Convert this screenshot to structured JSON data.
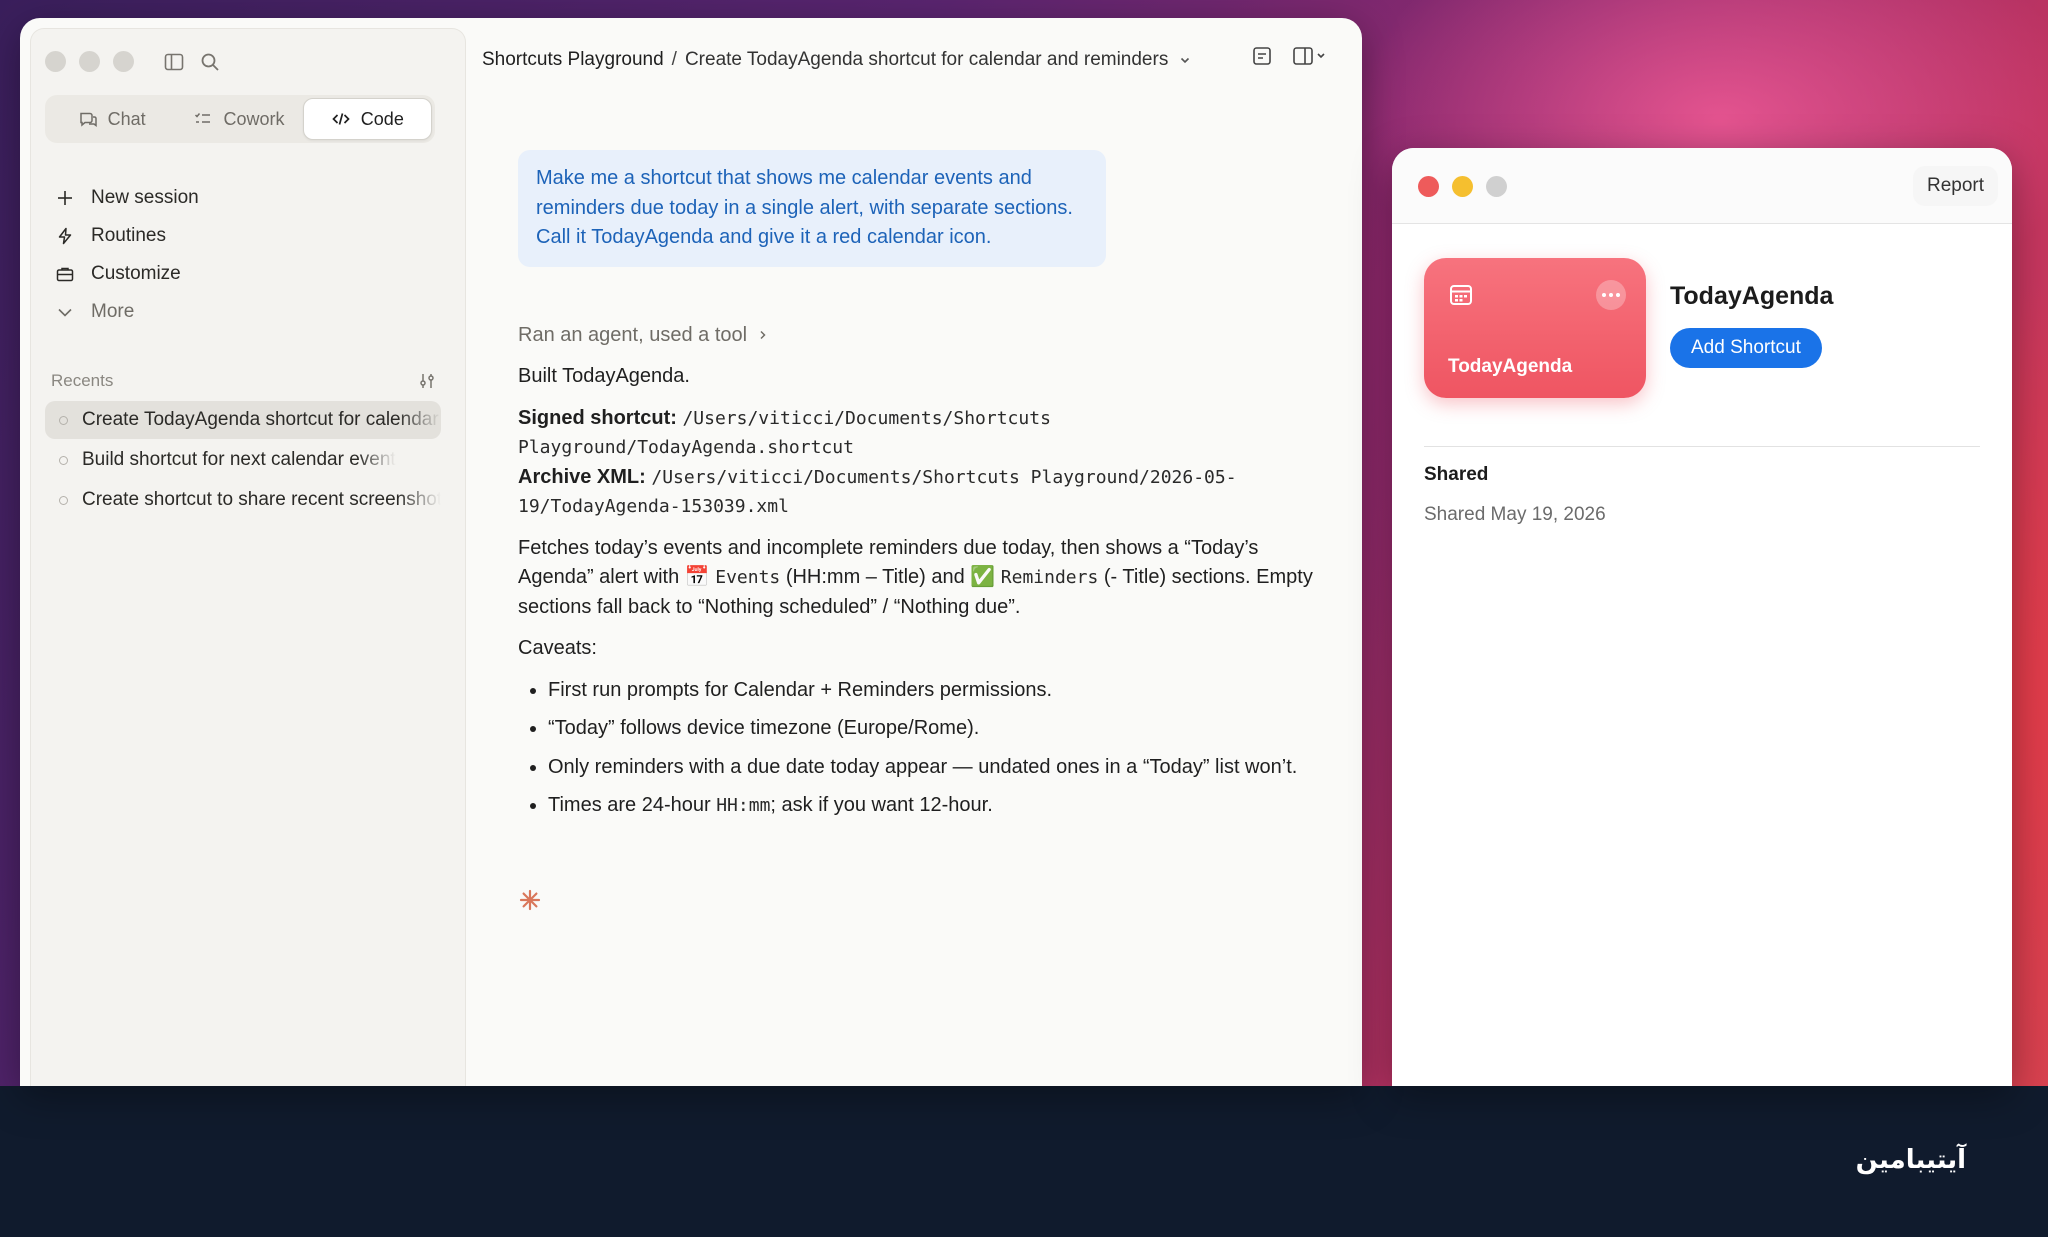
{
  "main_window": {
    "sidebar": {
      "mode_tabs": [
        {
          "label": "Chat",
          "icon": "chat-icon"
        },
        {
          "label": "Cowork",
          "icon": "checklist-icon"
        },
        {
          "label": "Code",
          "icon": "code-icon",
          "active": true
        }
      ],
      "nav_items": [
        {
          "label": "New session",
          "icon": "plus-icon"
        },
        {
          "label": "Routines",
          "icon": "bolt-icon"
        },
        {
          "label": "Customize",
          "icon": "briefcase-icon"
        },
        {
          "label": "More",
          "icon": "chevron-down-icon"
        }
      ],
      "recents_label": "Recents",
      "recents": [
        {
          "label": "Create TodayAgenda shortcut for calendar and reminders",
          "active": true
        },
        {
          "label": "Build shortcut for next calendar event"
        },
        {
          "label": "Create shortcut to share recent screenshots"
        }
      ]
    },
    "header": {
      "project": "Shortcuts Playground",
      "separator": "/",
      "title": "Create TodayAgenda shortcut for calendar and reminders"
    },
    "conversation": {
      "user_message": "Make me a shortcut that shows me calendar events and reminders due today in a single alert, with separate sections. Call it TodayAgenda and give it a red calendar icon.",
      "tool_summary": "Ran an agent, used a tool",
      "built": "Built TodayAgenda.",
      "signed_label": "Signed shortcut:",
      "signed_path": "/Users/viticci/Documents/Shortcuts Playground/TodayAgenda.shortcut",
      "archive_label": "Archive XML:",
      "archive_path": "/Users/viticci/Documents/Shortcuts Playground/2026-05-19/TodayAgenda-153039.xml",
      "desc_1": "Fetches today’s events and incomplete reminders due today, then shows a “Today’s Agenda” alert with ",
      "desc_events_emoji": "📅",
      "desc_events": "Events",
      "desc_2": " (HH:mm – Title) and ",
      "desc_reminders_emoji": "✅",
      "desc_reminders": "Reminders",
      "desc_3": " (- Title) sections. Empty sections fall back to “Nothing scheduled” / “Nothing due”.",
      "caveats_label": "Caveats:",
      "caveats": [
        "First run prompts for Calendar + Reminders permissions.",
        "“Today” follows device timezone (Europe/Rome).",
        "Only reminders with a due date today appear — undated ones in a “Today” list won’t."
      ],
      "caveat_4_pre": "Times are 24-hour ",
      "caveat_4_code": "HH:mm",
      "caveat_4_post": "; ask if you want 12-hour."
    }
  },
  "shortcut_window": {
    "report_label": "Report",
    "tile_name": "TodayAgenda",
    "name": "TodayAgenda",
    "add_button": "Add Shortcut",
    "shared_title": "Shared",
    "shared_date": "Shared May 19, 2026",
    "tile_color": "#ef5562",
    "button_color": "#1a73e8"
  },
  "colors": {
    "traffic_close": "#ee5b5b",
    "traffic_minimize": "#f5bf2f",
    "traffic_zoom": "#d0d0d0",
    "spark": "#d9775a",
    "user_bubble_text": "#1d63b8"
  },
  "watermark": "آیتیبامین"
}
